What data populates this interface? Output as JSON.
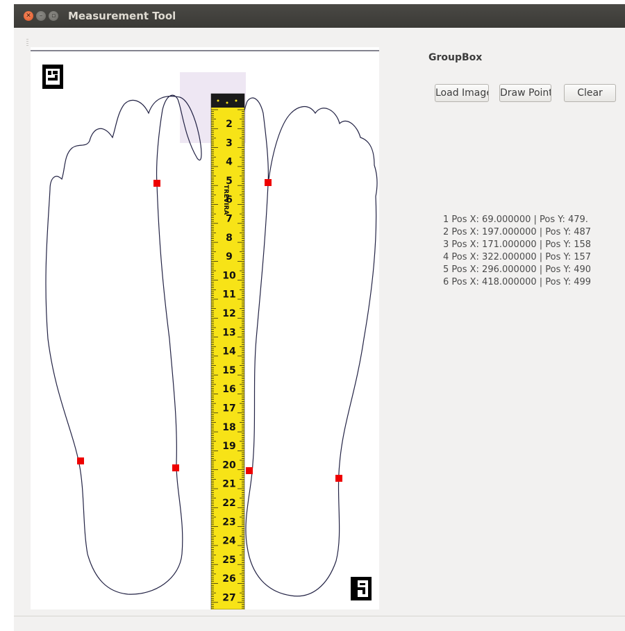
{
  "window": {
    "title": "Measurement Tool",
    "controls": [
      "close-icon",
      "minimize-icon",
      "maximize-icon"
    ]
  },
  "image": {
    "description_marks": [
      "aruco-marker-top-left",
      "aruco-marker-bottom-right",
      "measuring-tape"
    ],
    "tape_numbers": [
      "2",
      "3",
      "4",
      "5",
      "6",
      "7",
      "8",
      "9",
      "10",
      "11",
      "12",
      "13",
      "14",
      "15",
      "16",
      "17",
      "18",
      "19",
      "20",
      "21",
      "22",
      "23",
      "24",
      "25",
      "26",
      "27"
    ],
    "tape_brand": "TREVIRA",
    "point_color": "#ee0000",
    "tape_color": "#f7e317"
  },
  "groupbox": {
    "title": "GroupBox",
    "buttons": {
      "load": "Load Image",
      "draw": "Draw Points",
      "clear": "Clear"
    },
    "points": [
      "1 Pos X: 69.000000 | Pos Y: 479.",
      "2 Pos X: 197.000000 | Pos Y: 487",
      "3 Pos X: 171.000000 | Pos Y: 158",
      "4 Pos X: 322.000000 | Pos Y: 157",
      "5 Pos X: 296.000000 | Pos Y: 490",
      "6 Pos X: 418.000000 | Pos Y: 499"
    ]
  }
}
